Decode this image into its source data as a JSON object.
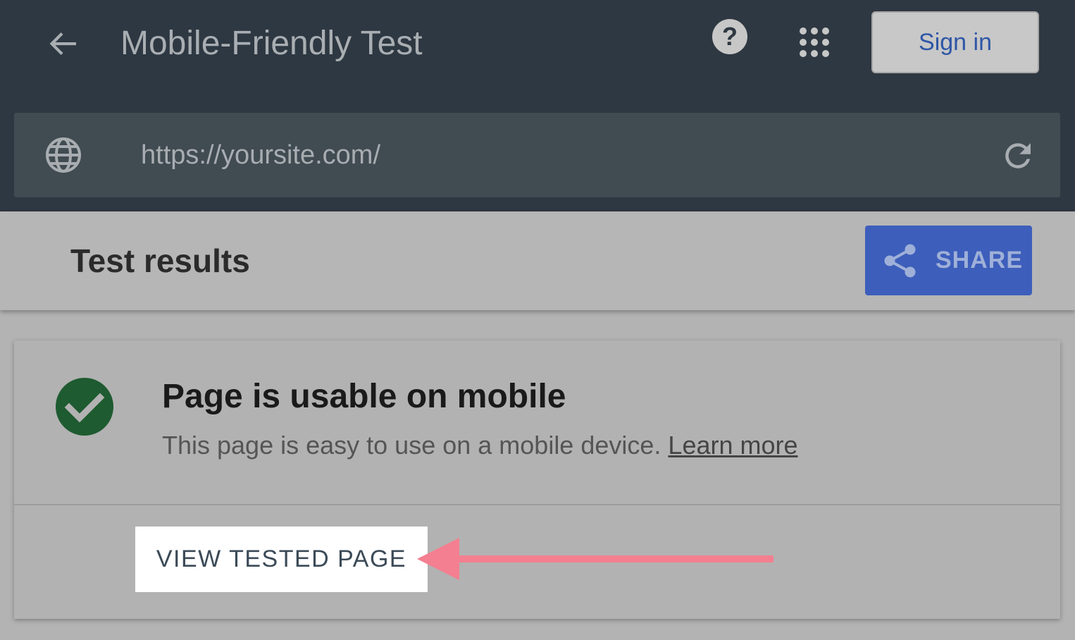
{
  "header": {
    "title": "Mobile-Friendly Test",
    "back_icon": "arrow-back-icon",
    "help_icon": "help-icon",
    "apps_icon": "apps-grid-icon",
    "sign_in_label": "Sign in"
  },
  "url_bar": {
    "globe_icon": "globe-icon",
    "url": "https://yoursite.com/",
    "reload_icon": "reload-icon"
  },
  "results": {
    "title": "Test results",
    "share_label": "SHARE",
    "share_icon": "share-icon"
  },
  "result_card": {
    "status_icon": "check-circle-icon",
    "heading": "Page is usable on mobile",
    "description": "This page is easy to use on a mobile device.",
    "learn_more": "Learn more",
    "view_button_label": "VIEW TESTED PAGE"
  },
  "annotation": {
    "arrow_icon": "arrow-left-annotation",
    "arrow_color": "#f47f90"
  },
  "colors": {
    "header_bg": "#2e3842",
    "url_bar_bg": "#414b52",
    "share_bg": "#3d5ebb",
    "check_green": "#1e5b30",
    "sign_in_text": "#2f56a6"
  }
}
